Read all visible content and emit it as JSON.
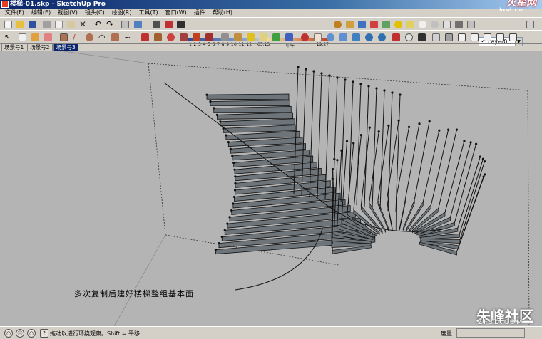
{
  "window": {
    "title": "楼梯-01.skp - SketchUp Pro",
    "logo_text": "火星网",
    "logo_sub": "hxsd.com"
  },
  "menubar": {
    "items": [
      "文件(F)",
      "编辑(E)",
      "视图(V)",
      "镜头(C)",
      "绘图(R)",
      "工具(T)",
      "窗口(W)",
      "插件",
      "帮助(H)"
    ]
  },
  "shadow": {
    "months": "1 2 3 4 5 6 7 8 9 10 11 12",
    "time_left": "05:13",
    "noon": "中午",
    "time_right": "19:27"
  },
  "layers": {
    "current": "Layer0",
    "check": "✓"
  },
  "scenes": {
    "tabs": [
      "场景号1",
      "场景号2",
      "场景号3"
    ],
    "active_index": 2
  },
  "viewport": {
    "caption": "多次复制后建好楼梯整组基本面",
    "watermark": "朱峰社区",
    "watermark_sub": "ZF3D.COM"
  },
  "status": {
    "hint": "拖动以进行环绕观察。Shift = 平移",
    "measure_label": "度量",
    "measure_value": ""
  },
  "toolbar_icons": [
    "new-icon",
    "open-icon",
    "save-icon",
    "cut-icon",
    "copy-icon",
    "paste-icon",
    "delete-icon",
    "undo-icon",
    "redo-icon",
    "print-icon",
    "model-info-icon",
    "select-icon",
    "component-icon",
    "paint-icon",
    "eraser-icon",
    "rectangle-icon",
    "line-icon",
    "circle-icon",
    "arc-icon",
    "polygon-icon",
    "freehand-icon",
    "move-icon",
    "push-pull-icon",
    "rotate-icon",
    "follow-me-icon",
    "scale-icon",
    "offset-icon",
    "tape-icon",
    "dimension-icon",
    "protractor-icon",
    "text-icon",
    "axes-icon",
    "3d-text-icon",
    "orbit-icon",
    "pan-icon",
    "zoom-icon",
    "zoom-window-icon",
    "zoom-extents-icon",
    "previous-icon",
    "next-icon",
    "position-camera-icon",
    "walk-icon",
    "look-around-icon",
    "section-icon",
    "xray-icon",
    "wireframe-icon",
    "hidden-line-icon",
    "shaded-icon",
    "iso-icon",
    "top-icon",
    "front-icon",
    "right-icon",
    "back-icon",
    "left-icon"
  ]
}
